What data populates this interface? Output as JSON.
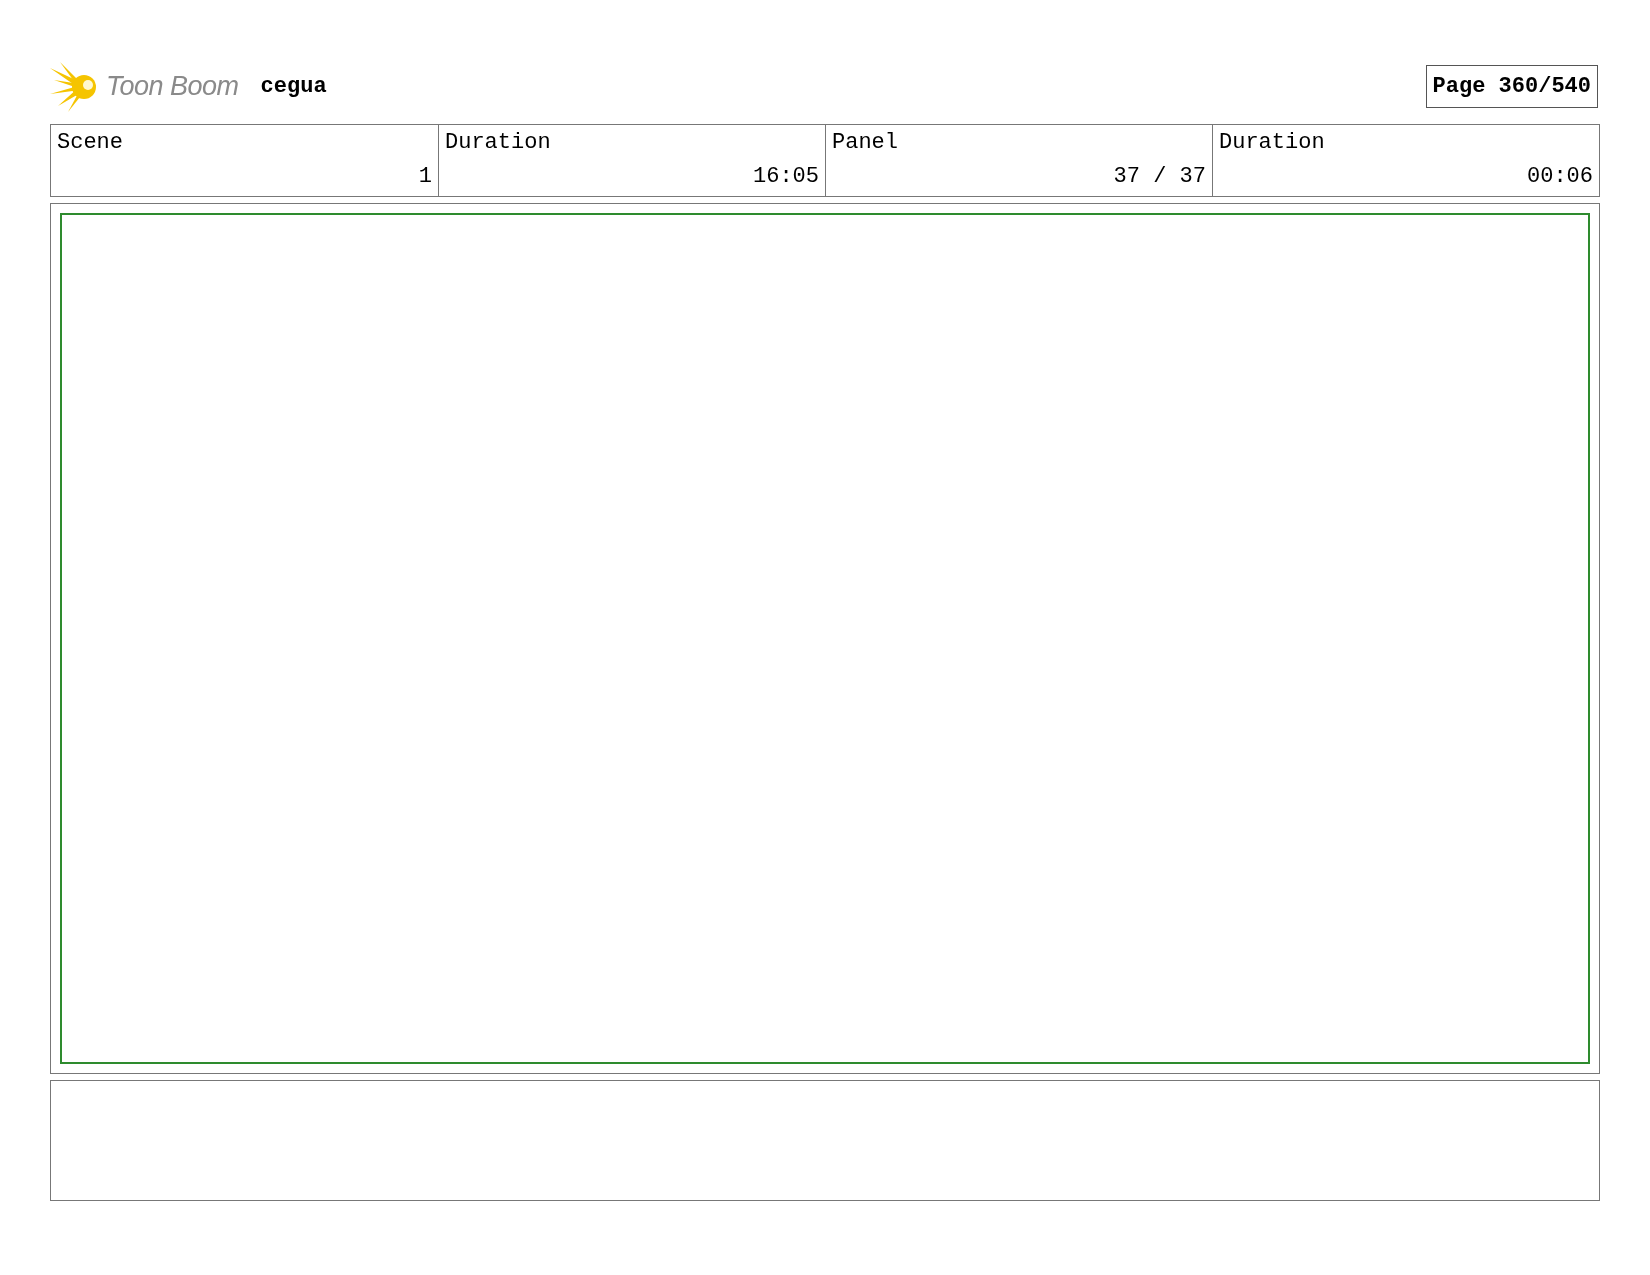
{
  "header": {
    "logo_text": "Toon Boom",
    "project": "cegua",
    "page": "Page 360/540"
  },
  "info_table": {
    "label_row": [
      "Scene",
      "Duration",
      "Panel",
      "Duration"
    ],
    "value_row": [
      "1",
      "16:05",
      "37 / 37",
      "00:06"
    ]
  }
}
